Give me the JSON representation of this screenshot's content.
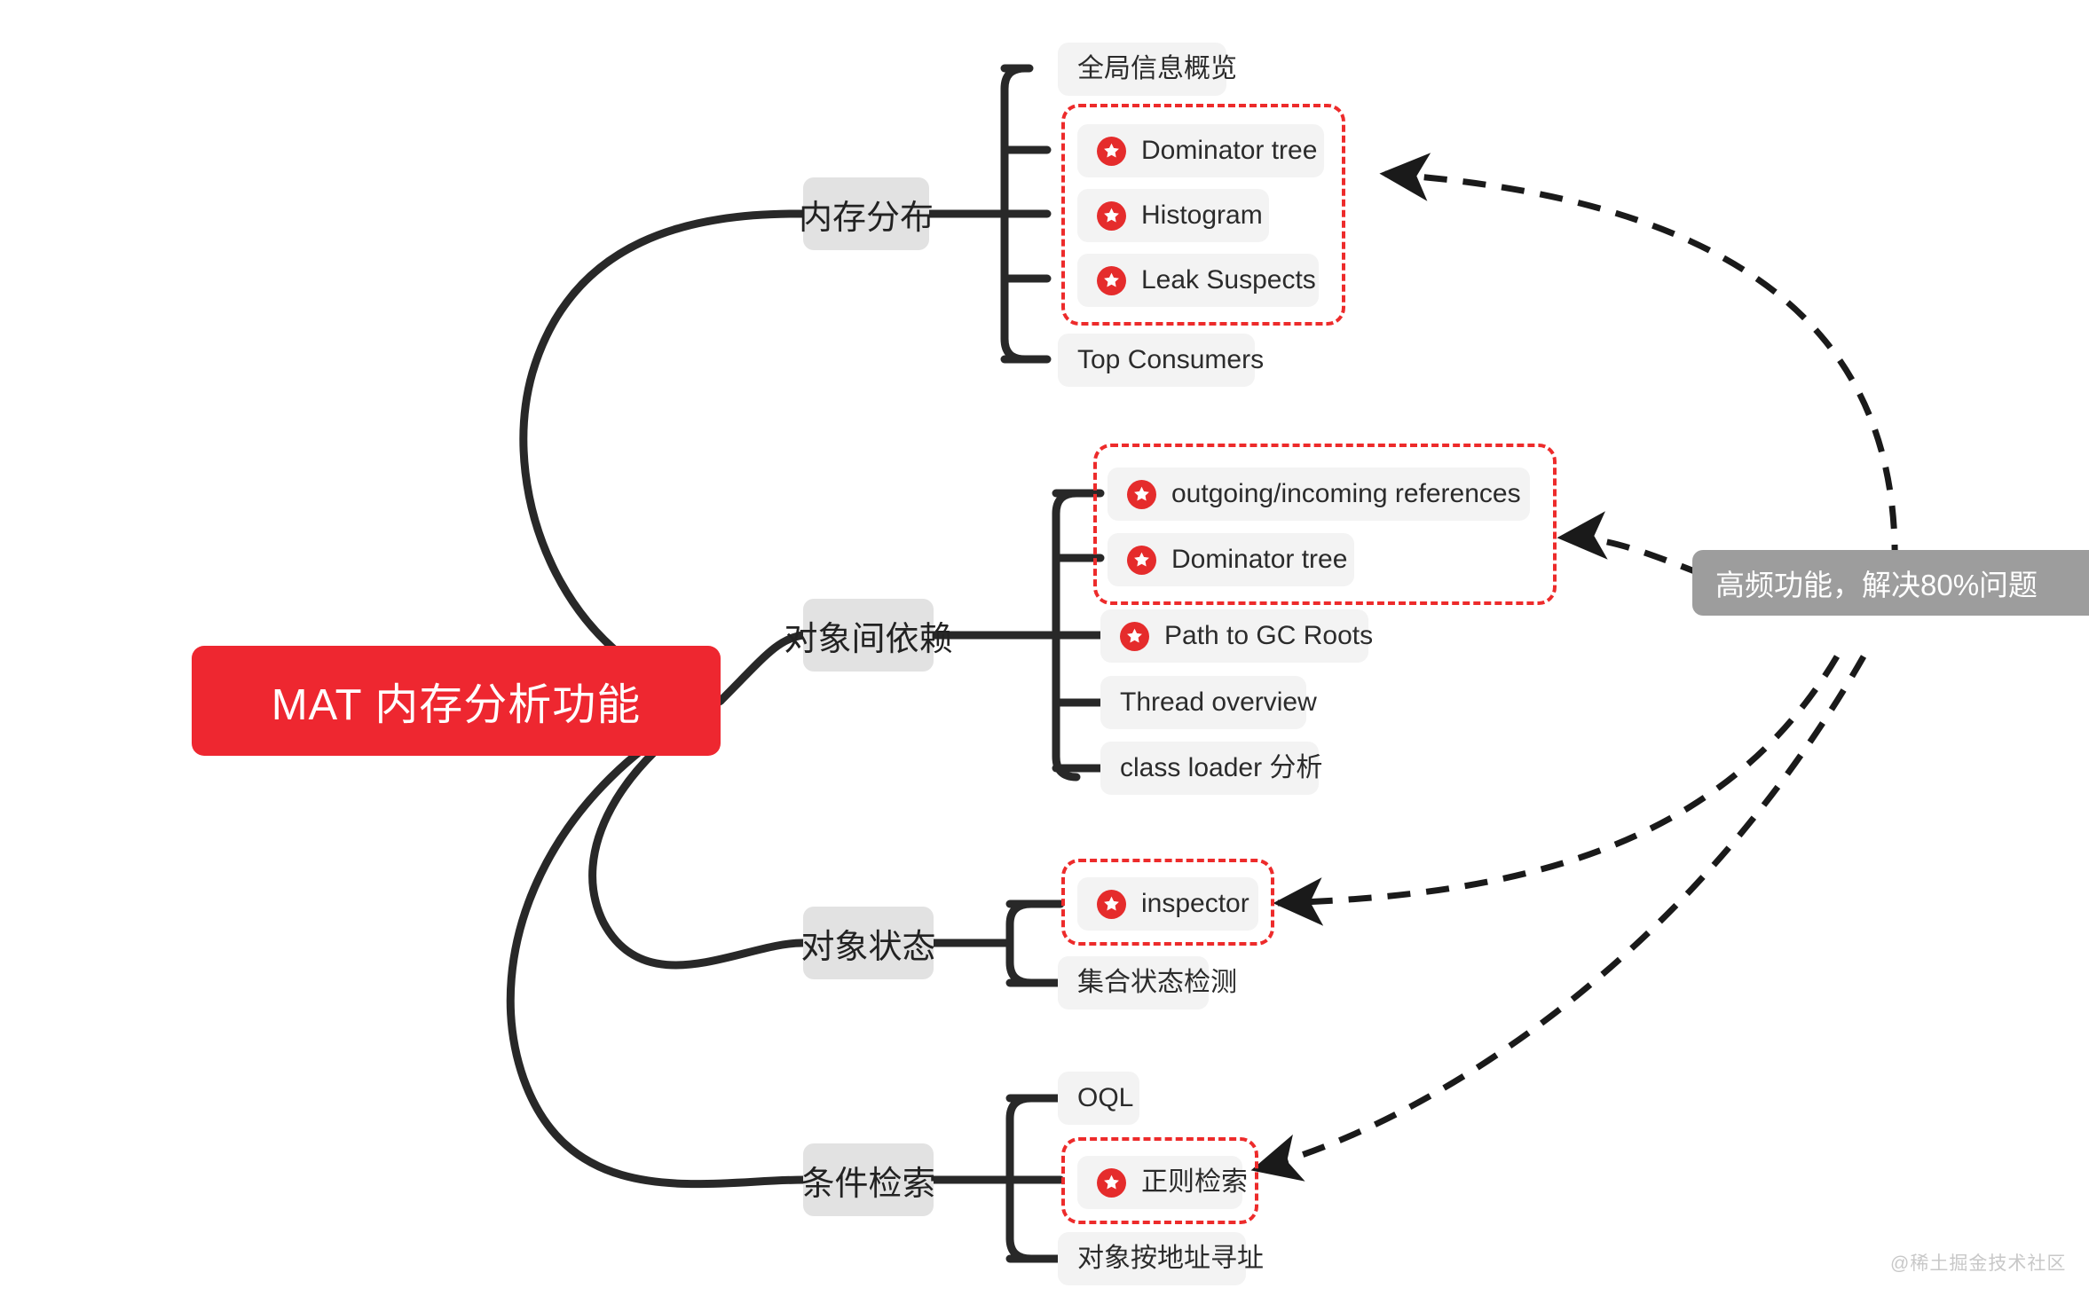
{
  "diagram": {
    "type": "mindmap",
    "root": {
      "label": "MAT 内存分析功能",
      "color": "#ee2730",
      "text_color": "#ffffff"
    },
    "highlight_color": "#ed2b2b",
    "branch_color": "#e2e2e2",
    "leaf_color": "#f3f3f3",
    "callout": {
      "label": "高频功能，解决80%问题",
      "color": "#9d9d9d"
    },
    "star_icon_name": "star-badge-icon",
    "branches": [
      {
        "label": "内存分布",
        "children": [
          {
            "label": "全局信息概览",
            "starred": false,
            "highlighted": false
          },
          {
            "label": "Dominator tree",
            "starred": true,
            "highlighted": true
          },
          {
            "label": "Histogram",
            "starred": true,
            "highlighted": true
          },
          {
            "label": "Leak Suspects",
            "starred": true,
            "highlighted": true
          },
          {
            "label": "Top Consumers",
            "starred": false,
            "highlighted": false
          }
        ]
      },
      {
        "label": "对象间依赖",
        "children": [
          {
            "label": "outgoing/incoming references",
            "starred": true,
            "highlighted": true
          },
          {
            "label": "Dominator tree",
            "starred": true,
            "highlighted": true
          },
          {
            "label": "Path to GC Roots",
            "starred": true,
            "highlighted": false
          },
          {
            "label": "Thread overview",
            "starred": false,
            "highlighted": false
          },
          {
            "label": "class loader 分析",
            "starred": false,
            "highlighted": false
          }
        ]
      },
      {
        "label": "对象状态",
        "children": [
          {
            "label": "inspector",
            "starred": true,
            "highlighted": true
          },
          {
            "label": "集合状态检测",
            "starred": false,
            "highlighted": false
          }
        ]
      },
      {
        "label": "条件检索",
        "children": [
          {
            "label": "OQL",
            "starred": false,
            "highlighted": false
          },
          {
            "label": "正则检索",
            "starred": true,
            "highlighted": true
          },
          {
            "label": "对象按地址寻址",
            "starred": false,
            "highlighted": false
          }
        ]
      }
    ]
  },
  "watermark": {
    "label": "@稀土掘金技术社区"
  }
}
